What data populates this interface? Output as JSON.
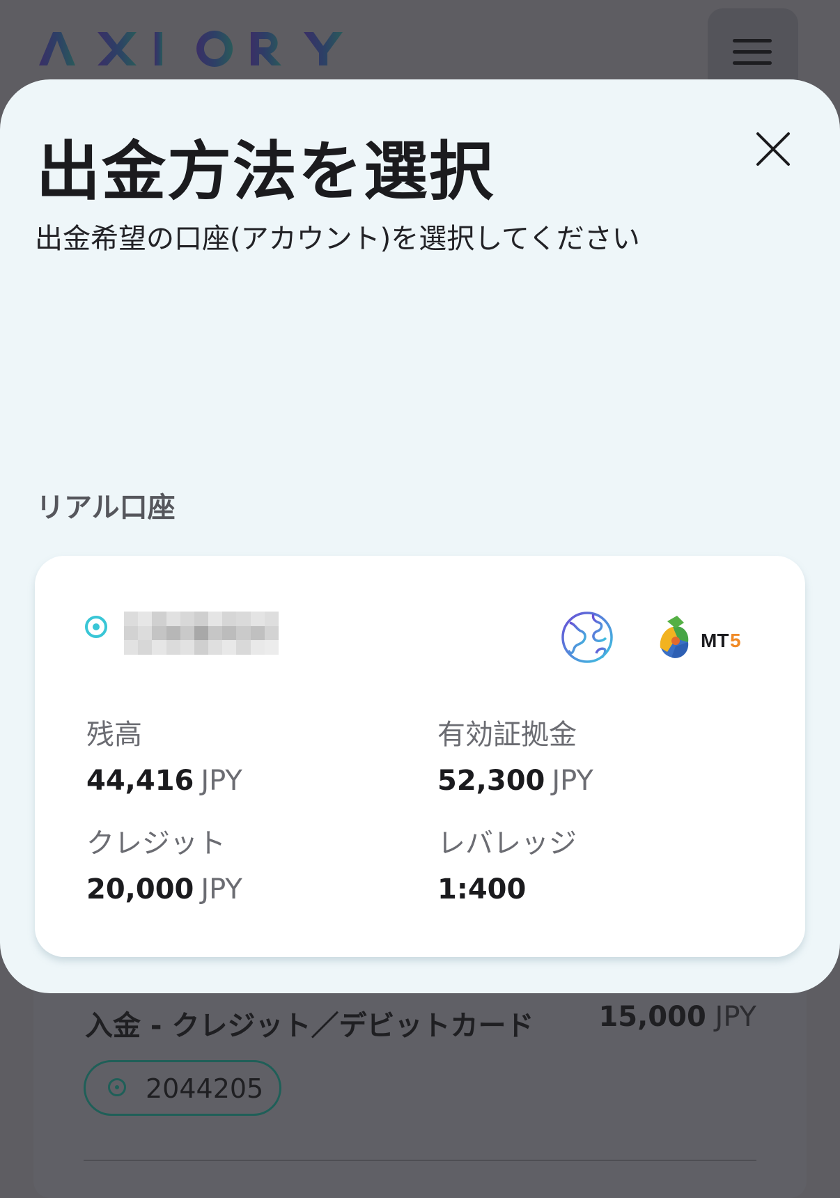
{
  "header": {
    "logo_text": "AXIORY",
    "menu_icon": "hamburger-menu-icon"
  },
  "modal": {
    "title": "出金方法を選択",
    "subtitle": "出金希望の口座(アカウント)を選択してください",
    "close_icon": "close-icon",
    "section_label": "リアル口座"
  },
  "account": {
    "selected": true,
    "account_id_redacted": true,
    "platform_icon": "globe-icon",
    "platform_logo": "MT5",
    "balance_label": "残高",
    "balance_value": "44,416",
    "balance_currency": "JPY",
    "margin_label": "有効証拠金",
    "margin_value": "52,300",
    "margin_currency": "JPY",
    "credit_label": "クレジット",
    "credit_value": "20,000",
    "credit_currency": "JPY",
    "leverage_label": "レバレッジ",
    "leverage_value": "1:400"
  },
  "background_transaction": {
    "title": "入金 - クレジット／デビットカード",
    "amount": "15,000",
    "currency": "JPY",
    "account_number": "2044205"
  },
  "colors": {
    "accent": "#39c6d6",
    "modal_bg": "#eef6f9",
    "overlay": "#5e5d62"
  }
}
